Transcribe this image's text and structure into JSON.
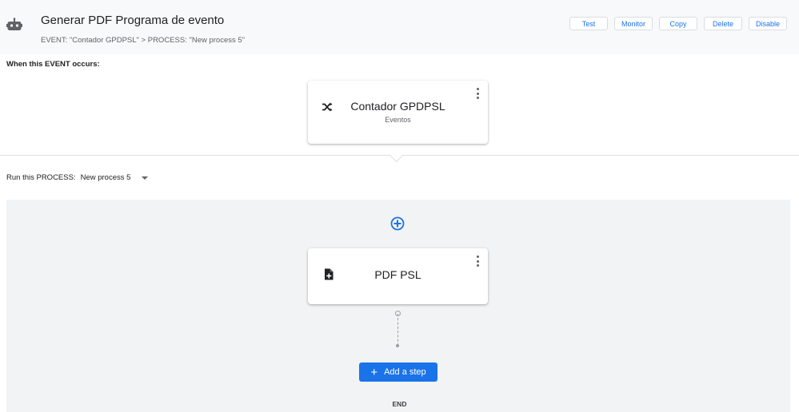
{
  "header": {
    "title": "Generar PDF Programa de evento",
    "breadcrumb": "EVENT: \"Contador GPDPSL\" > PROCESS: \"New process 5\"",
    "actions": {
      "test": "Test",
      "monitor": "Monitor",
      "copy": "Copy",
      "delete": "Delete",
      "disable": "Disable"
    },
    "icon": "robot-icon"
  },
  "event_section": {
    "label": "When this EVENT occurs:",
    "card": {
      "title": "Contador GPDPSL",
      "subtitle": "Eventos",
      "icon": "shuffle-icon"
    }
  },
  "process_section": {
    "label": "Run this PROCESS:",
    "selected_process": "New process 5",
    "step_card": {
      "title": "PDF PSL",
      "icon": "add-document-icon"
    },
    "add_step_label": "Add a step",
    "end_label": "END"
  },
  "colors": {
    "accent": "#1a73e8",
    "header_bg": "#f8f9fa",
    "process_bg": "#f1f3f4"
  }
}
